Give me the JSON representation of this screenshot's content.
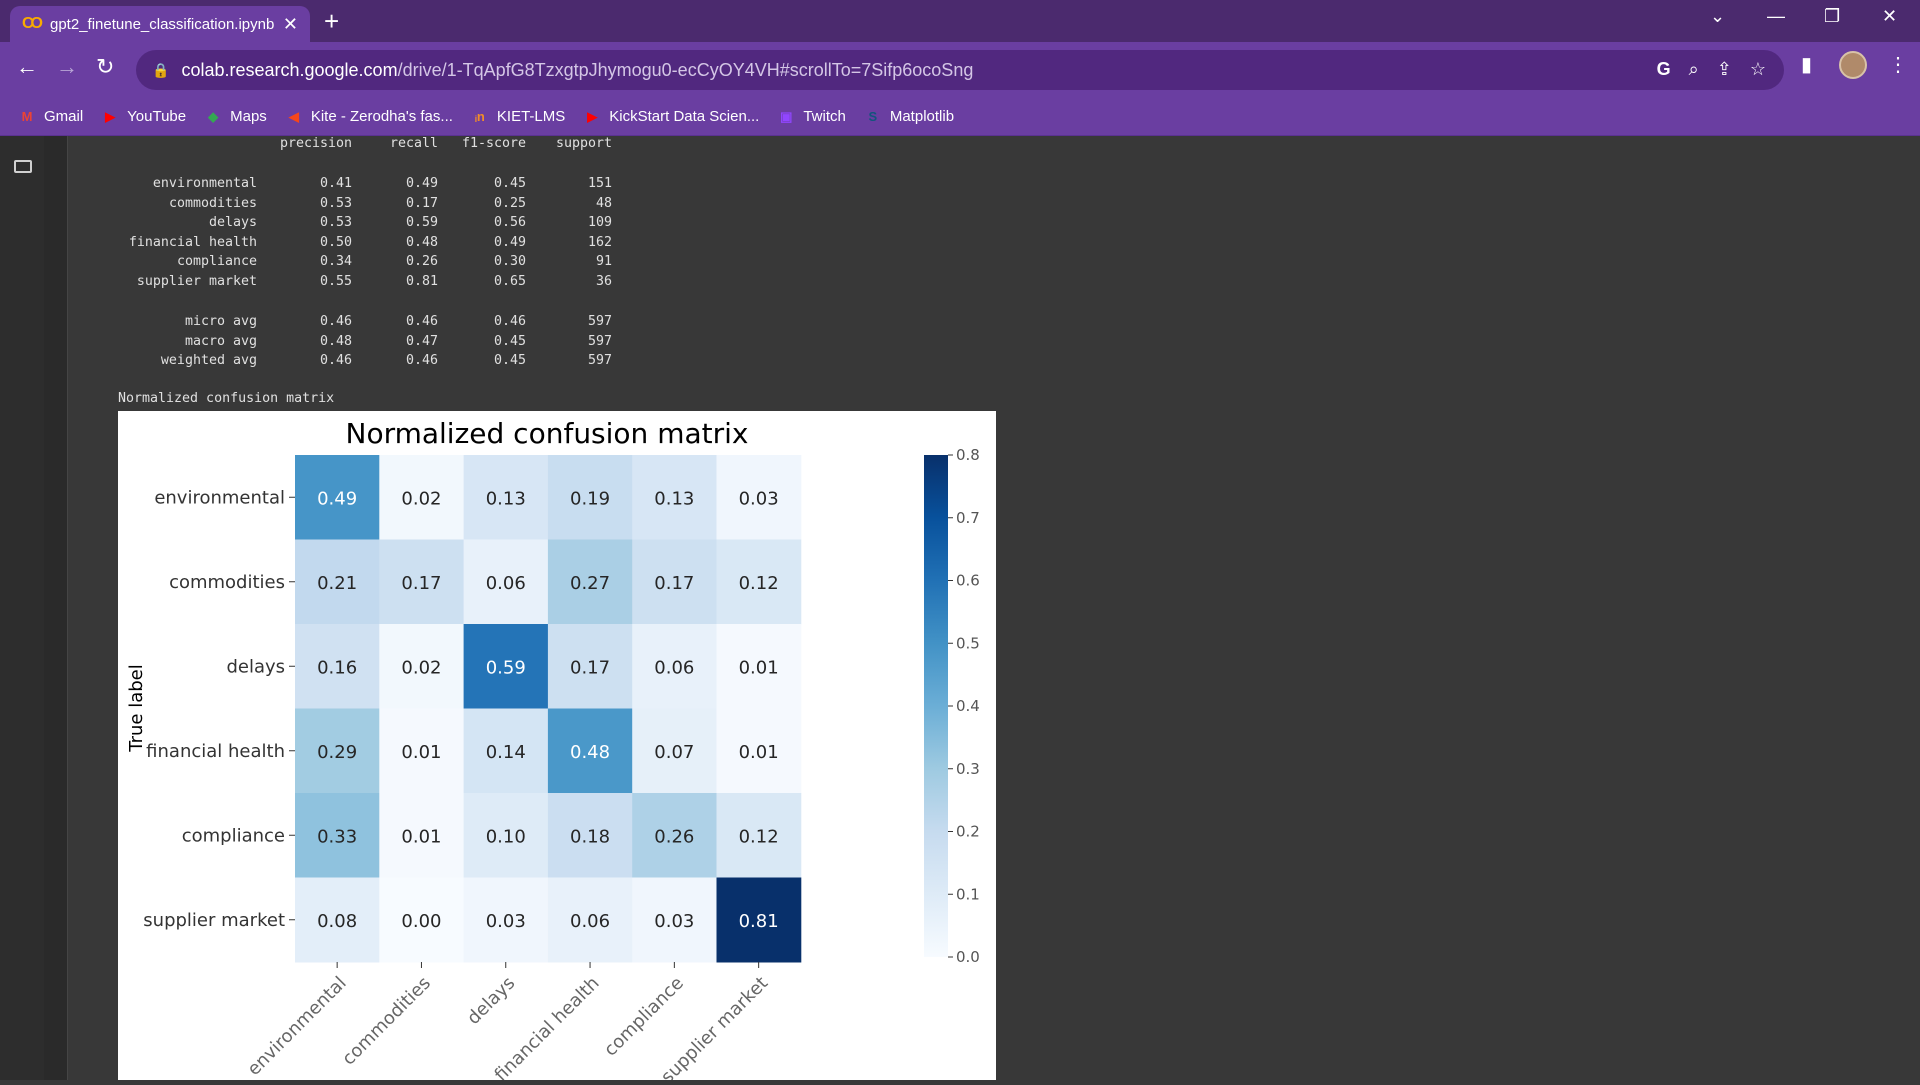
{
  "browser": {
    "tab_title": "gpt2_finetune_classification.ipynb",
    "tab_icon": "colab-icon",
    "url_host": "colab.research.google.com",
    "url_path": "/drive/1-TqApfG8TzxgtpJhymogu0-ecCyOY4VH#scrollTo=7Sifp6ocoSng",
    "bookmarks": [
      {
        "label": "Gmail",
        "icon": "gmail-icon",
        "color": "#ea4335"
      },
      {
        "label": "YouTube",
        "icon": "youtube-icon",
        "color": "#ff0000"
      },
      {
        "label": "Maps",
        "icon": "maps-icon",
        "color": "#34a853"
      },
      {
        "label": "Kite - Zerodha's fas...",
        "icon": "kite-icon",
        "color": "#f6461a"
      },
      {
        "label": "KIET-LMS",
        "icon": "kiet-icon",
        "color": "#f28c28"
      },
      {
        "label": "KickStart Data Scien...",
        "icon": "youtube-icon",
        "color": "#ff0000"
      },
      {
        "label": "Twitch",
        "icon": "twitch-icon",
        "color": "#9146ff"
      },
      {
        "label": "Matplotlib",
        "icon": "matplotlib-icon",
        "color": "#11557c"
      }
    ]
  },
  "report": {
    "headers": [
      "precision",
      "recall",
      "f1-score",
      "support"
    ],
    "rows": [
      {
        "label": "environmental",
        "precision": "0.41",
        "recall": "0.49",
        "f1": "0.45",
        "support": "151"
      },
      {
        "label": "commodities",
        "precision": "0.53",
        "recall": "0.17",
        "f1": "0.25",
        "support": "48"
      },
      {
        "label": "delays",
        "precision": "0.53",
        "recall": "0.59",
        "f1": "0.56",
        "support": "109"
      },
      {
        "label": "financial health",
        "precision": "0.50",
        "recall": "0.48",
        "f1": "0.49",
        "support": "162"
      },
      {
        "label": "compliance",
        "precision": "0.34",
        "recall": "0.26",
        "f1": "0.30",
        "support": "91"
      },
      {
        "label": "supplier market",
        "precision": "0.55",
        "recall": "0.81",
        "f1": "0.65",
        "support": "36"
      }
    ],
    "averages": [
      {
        "label": "micro avg",
        "precision": "0.46",
        "recall": "0.46",
        "f1": "0.46",
        "support": "597"
      },
      {
        "label": "macro avg",
        "precision": "0.48",
        "recall": "0.47",
        "f1": "0.45",
        "support": "597"
      },
      {
        "label": "weighted avg",
        "precision": "0.46",
        "recall": "0.46",
        "f1": "0.45",
        "support": "597"
      }
    ]
  },
  "cm_caption": "Normalized confusion matrix",
  "chart_data": {
    "type": "heatmap",
    "title": "Normalized confusion matrix",
    "ylabel": "True label",
    "xlabel": "",
    "rows": [
      "environmental",
      "commodities",
      "delays",
      "financial health",
      "compliance",
      "supplier market"
    ],
    "columns": [
      "environmental",
      "commodities",
      "delays",
      "financial health",
      "compliance",
      "supplier market"
    ],
    "values": [
      [
        0.49,
        0.02,
        0.13,
        0.19,
        0.13,
        0.03
      ],
      [
        0.21,
        0.17,
        0.06,
        0.27,
        0.17,
        0.12
      ],
      [
        0.16,
        0.02,
        0.59,
        0.17,
        0.06,
        0.01
      ],
      [
        0.29,
        0.01,
        0.14,
        0.48,
        0.07,
        0.01
      ],
      [
        0.33,
        0.01,
        0.1,
        0.18,
        0.26,
        0.12
      ],
      [
        0.08,
        0.0,
        0.03,
        0.06,
        0.03,
        0.81
      ]
    ],
    "colorbar": {
      "min": 0.0,
      "max": 0.8,
      "ticks": [
        "0.0",
        "0.1",
        "0.2",
        "0.3",
        "0.4",
        "0.5",
        "0.6",
        "0.7",
        "0.8"
      ]
    },
    "colormap": "Blues"
  }
}
